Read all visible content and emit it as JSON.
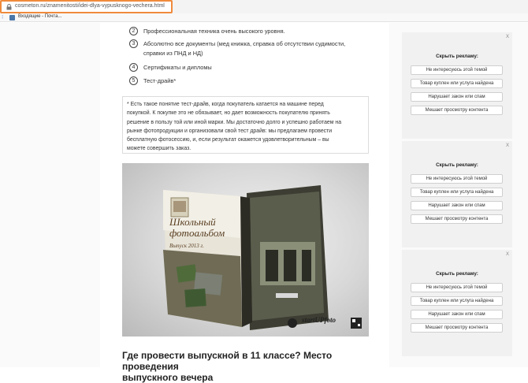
{
  "browser": {
    "url": "cosmeton.ru/znamenitosti/idei-dlya-vypusknogo-vechera.html",
    "bookmark_label": "Входящие - Почта..."
  },
  "article": {
    "items": [
      {
        "num": "2",
        "text": "Профессиональная техника очень высокого уровня."
      },
      {
        "num": "3",
        "text": "Абсолютно все документы (мед книжка, справка об отсутствии судимости,",
        "text2": "справки из ПНД и НД)"
      },
      {
        "num": "4",
        "text": "Сертификаты и дипломы"
      },
      {
        "num": "5",
        "text": "Тест-драйв*"
      }
    ],
    "note_lines": [
      "* Есть такое понятие тест-драйв, когда покупатель катается на машине перед",
      "покупкой. К покупке это не обязывает, но дает возможность покупателю принять",
      "решение в пользу той или иной марки. Мы достаточно долго и успешно работаем на",
      "рынке фотопродукции и организовали свой тест драйв: мы предлагаем провести",
      "бесплатную фотосессию, и, если результат окажется удовлетворительным – вы",
      "можете совершить заказ."
    ],
    "album": {
      "title_line1": "Школьный",
      "title_line2": "фотоальбом",
      "subtitle": "Выпуск 2013 г.",
      "brand": "startUPfoto"
    },
    "heading_line1": "Где провести выпускной в 11 классе? Место проведения",
    "heading_line2": "выпускного вечера"
  },
  "ads": {
    "title": "Скрыть рекламу:",
    "close": "X",
    "buttons": [
      "Не интересуюсь этой темой",
      "Товар куплен или услуга найдена",
      "Нарушает закон или спам",
      "Мешает просмотру контента"
    ]
  }
}
